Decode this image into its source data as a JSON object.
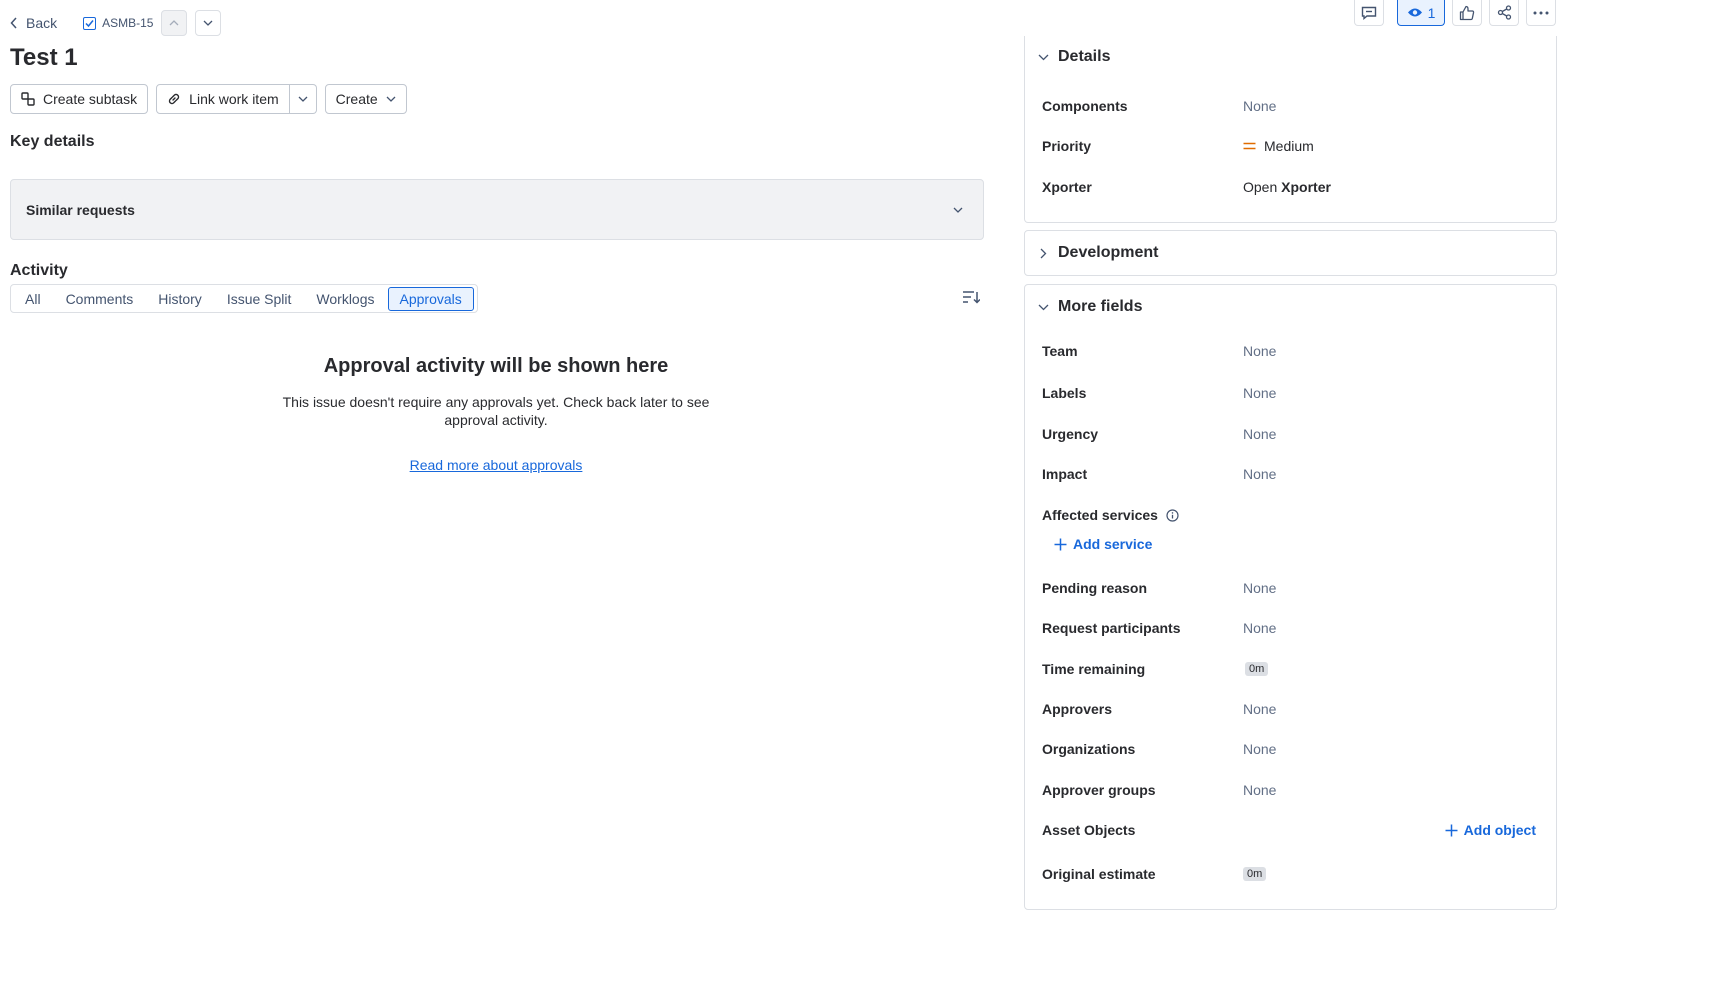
{
  "header": {
    "back_label": "Back",
    "issue_key": "ASMB-15",
    "title": "Test 1"
  },
  "actions": {
    "create_subtask": "Create subtask",
    "link_work_item": "Link work item",
    "create": "Create"
  },
  "key_details": {
    "heading": "Key details",
    "similar_requests": "Similar requests"
  },
  "activity": {
    "heading": "Activity",
    "tabs": [
      "All",
      "Comments",
      "History",
      "Issue Split",
      "Worklogs",
      "Approvals"
    ],
    "active_tab": "Approvals",
    "empty_title": "Approval activity will be shown here",
    "empty_line1": "This issue doesn't require any approvals yet. Check back later to see",
    "empty_line2": "approval activity.",
    "read_more": "Read more about approvals"
  },
  "toolbar": {
    "watch_count": "1"
  },
  "details": {
    "heading": "Details",
    "components_label": "Components",
    "components_value": "None",
    "priority_label": "Priority",
    "priority_value": "Medium",
    "xporter_label": "Xporter",
    "xporter_value_prefix": "Open",
    "xporter_value": "Xporter"
  },
  "development": {
    "heading": "Development"
  },
  "more_fields": {
    "heading": "More fields",
    "team_label": "Team",
    "team_value": "None",
    "labels_label": "Labels",
    "labels_value": "None",
    "urgency_label": "Urgency",
    "urgency_value": "None",
    "impact_label": "Impact",
    "impact_value": "None",
    "affected_label": "Affected services",
    "add_service": "Add service",
    "pending_label": "Pending reason",
    "pending_value": "None",
    "participants_label": "Request participants",
    "participants_value": "None",
    "time_label": "Time remaining",
    "time_value": "0m",
    "approvers_label": "Approvers",
    "approvers_value": "None",
    "orgs_label": "Organizations",
    "orgs_value": "None",
    "approver_groups_label": "Approver groups",
    "approver_groups_value": "None",
    "asset_label": "Asset Objects",
    "add_object": "Add object",
    "estimate_label": "Original estimate",
    "estimate_value": "0m"
  },
  "colors": {
    "accent": "#1868db",
    "priority_medium": "#e06c00"
  }
}
